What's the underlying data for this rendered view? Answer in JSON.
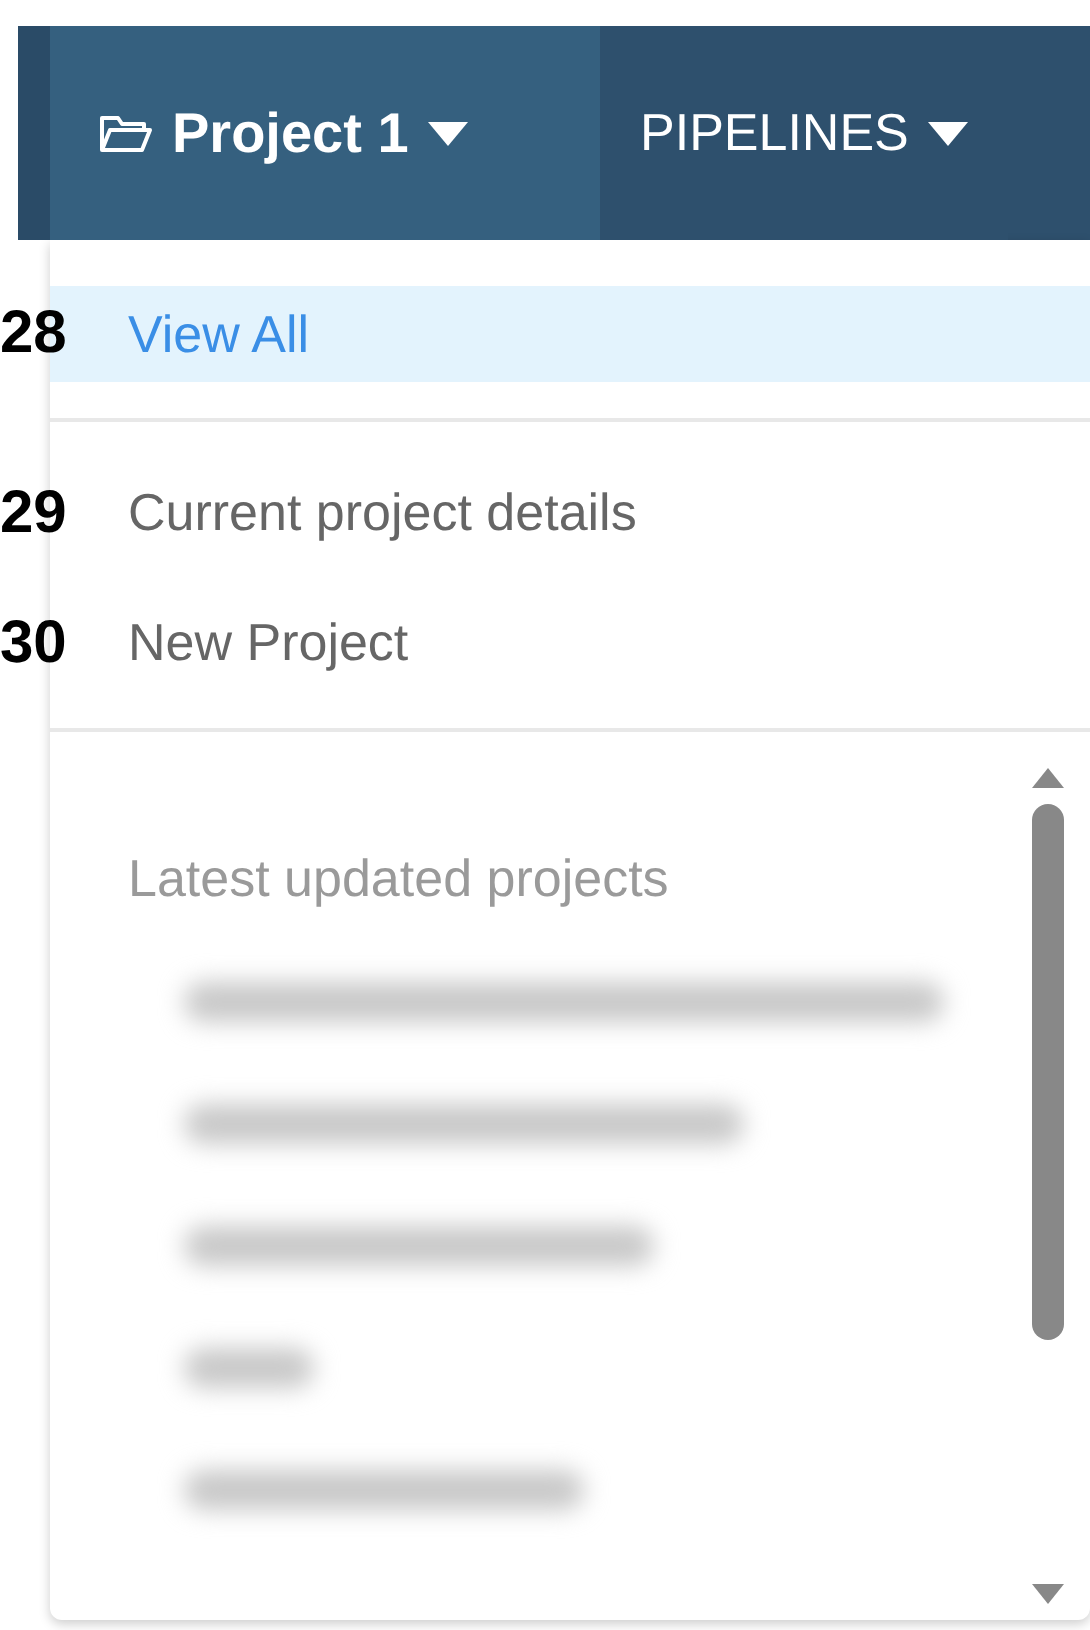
{
  "navbar": {
    "tabs": [
      {
        "label": "Project 1",
        "kind": "project",
        "selected": true
      },
      {
        "label": "PIPELINES",
        "kind": "menu",
        "selected": false
      }
    ]
  },
  "dropdown": {
    "items": [
      {
        "label": "View All",
        "marker": "28",
        "selected": true,
        "divider_after": true
      },
      {
        "label": "Current project details",
        "marker": "29",
        "selected": false,
        "divider_after": false
      },
      {
        "label": "New Project",
        "marker": "30",
        "selected": false,
        "divider_after": true
      }
    ],
    "section_title": "Latest updated projects",
    "recent_projects": [
      {
        "kind": "redacted"
      },
      {
        "kind": "redacted"
      },
      {
        "kind": "redacted"
      },
      {
        "kind": "redacted"
      },
      {
        "kind": "redacted"
      }
    ]
  }
}
